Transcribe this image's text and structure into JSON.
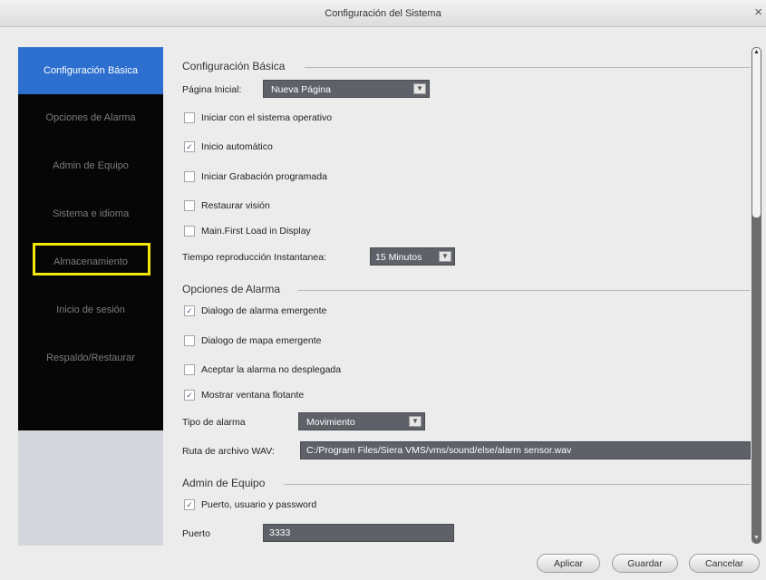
{
  "window": {
    "title": "Configuración del Sistema",
    "close_glyph": "×"
  },
  "sidebar": {
    "items": [
      {
        "label": "Configuración Básica"
      },
      {
        "label": "Opciones de Alarma"
      },
      {
        "label": "Admin de Equipo"
      },
      {
        "label": "Sistema e idioma"
      },
      {
        "label": "Almacenamiento"
      },
      {
        "label": "Inicio de sesión"
      },
      {
        "label": "Respaldo/Restaurar"
      }
    ],
    "active_index": 0,
    "highlighted_index": 4
  },
  "basic": {
    "section_title": "Configuración Básica",
    "start_page_label": "Página Inicial:",
    "start_page_value": "Nueva Página",
    "checkboxes": [
      {
        "label": "Iniciar con el sistema operativo",
        "checked": false
      },
      {
        "label": "Inicio automático",
        "checked": true
      },
      {
        "label": "Iniciar Grabación programada",
        "checked": false
      },
      {
        "label": "Restaurar visión",
        "checked": false
      },
      {
        "label": "Main.First Load in Display",
        "checked": false
      }
    ],
    "instant_playback_label": "Tiempo reproducción Instantanea:",
    "instant_playback_value": "15 Minutos"
  },
  "alarm": {
    "section_title": "Opciones de Alarma",
    "checkboxes": [
      {
        "label": "Dialogo de alarma emergente",
        "checked": true
      },
      {
        "label": "Dialogo de mapa emergente",
        "checked": false
      },
      {
        "label": "Aceptar la alarma no desplegada",
        "checked": false
      },
      {
        "label": "Mostrar ventana flotante",
        "checked": true
      }
    ],
    "alarm_type_label": "Tipo de alarma",
    "alarm_type_value": "Movimiento",
    "wav_path_label": "Ruta de archivo WAV:",
    "wav_path_value": "C:/Program Files/Siera VMS/vms/sound/else/alarm sensor.wav"
  },
  "device": {
    "section_title": "Admin de Equipo",
    "checkboxes": [
      {
        "label": "Puerto, usuario y password",
        "checked": true
      }
    ],
    "port_label": "Puerto",
    "port_value": "3333"
  },
  "buttons": {
    "apply": "Aplicar",
    "save": "Guardar",
    "cancel": "Cancelar"
  },
  "colors": {
    "active_tab": "#2c6fcf",
    "highlight_box": "#f3e60a",
    "dropdown_bg": "#5f6169"
  },
  "glyphs": {
    "check": "✓",
    "dropdown_arrow": "▼",
    "scroll_up": "▲",
    "scroll_down": "▼"
  }
}
